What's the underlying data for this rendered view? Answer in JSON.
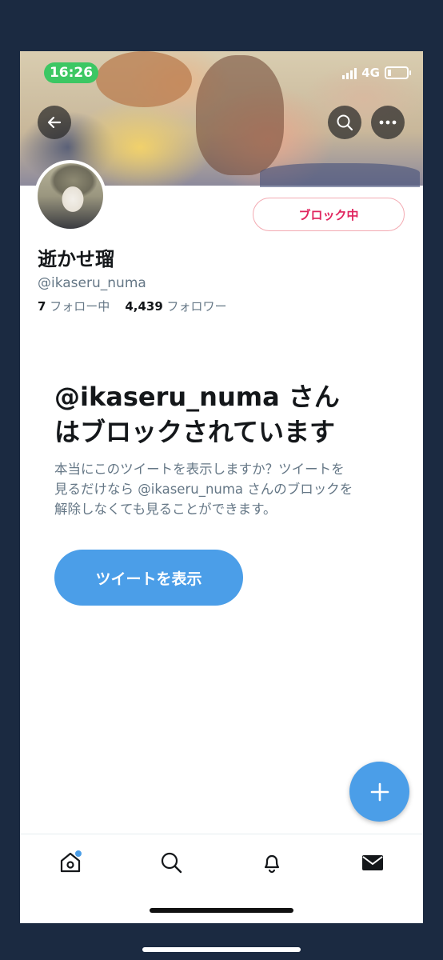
{
  "status_bar": {
    "time": "16:26",
    "network": "4G"
  },
  "profile": {
    "name": "逝かせ瑠",
    "handle": "@ikaseru_numa",
    "following_count": "7",
    "following_label": "フォロー中",
    "followers_count": "4,439",
    "followers_label": "フォロワー",
    "block_button_label": "ブロック中"
  },
  "blocked_notice": {
    "title_line1": "@ikaseru_numa さん",
    "title_line2": "はブロックされています",
    "desc_line1": "本当にこのツイートを表示しますか？ツイートを",
    "desc_line2": "見るだけなら @ikaseru_numa さんのブロックを",
    "desc_line3": "解除しなくても見ることができます。",
    "show_button_label": "ツイートを表示"
  },
  "tabs": [
    "home-icon",
    "search-icon",
    "bell-icon",
    "mail-icon"
  ],
  "colors": {
    "accent": "#4b9ee8",
    "block_red": "#e0245e",
    "status_green": "#3cc763",
    "background": "#1b2a41"
  }
}
